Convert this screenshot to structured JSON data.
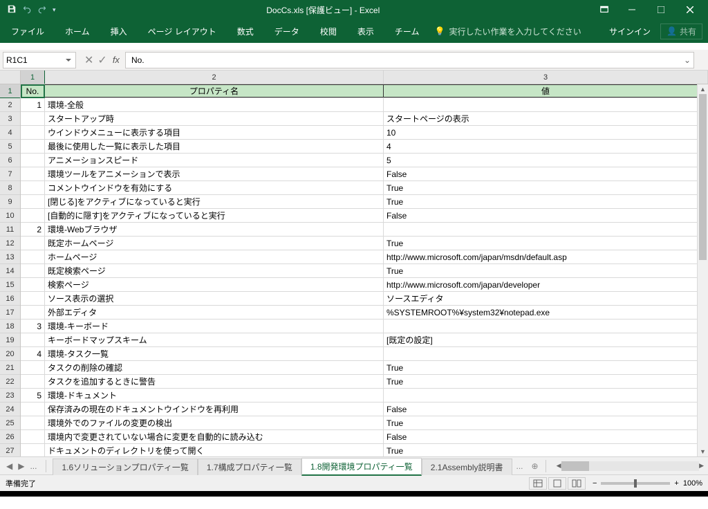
{
  "title": "DocCs.xls [保護ビュー] - Excel",
  "ribbon": {
    "file": "ファイル",
    "home": "ホーム",
    "insert": "挿入",
    "pagelayout": "ページ レイアウト",
    "formulas": "数式",
    "data": "データ",
    "review": "校閲",
    "view": "表示",
    "team": "チーム",
    "tellme": "実行したい作業を入力してください",
    "signin": "サインイン",
    "share": "共有"
  },
  "namebox": "R1C1",
  "fx_symbol": "fx",
  "formula": "No.",
  "col_headers": [
    "1",
    "2",
    "3"
  ],
  "chart_data": {
    "type": "table",
    "columns": [
      "No.",
      "プロパティ名",
      "値"
    ],
    "rows": [
      {
        "no": "1",
        "name": "環境-全般",
        "value": ""
      },
      {
        "no": "",
        "name": "スタートアップ時",
        "value": "スタートページの表示"
      },
      {
        "no": "",
        "name": "ウインドウメニューに表示する項目",
        "value": "10"
      },
      {
        "no": "",
        "name": "最後に使用した一覧に表示した項目",
        "value": "4"
      },
      {
        "no": "",
        "name": "アニメーションスピード",
        "value": "5"
      },
      {
        "no": "",
        "name": "環境ツールをアニメーションで表示",
        "value": "False"
      },
      {
        "no": "",
        "name": "コメントウインドウを有効にする",
        "value": "True"
      },
      {
        "no": "",
        "name": "[閉じる]をアクティブになっていると実行",
        "value": "True"
      },
      {
        "no": "",
        "name": "[自動的に隠す]をアクティブになっていると実行",
        "value": "False"
      },
      {
        "no": "2",
        "name": "環境-Webブラウザ",
        "value": ""
      },
      {
        "no": "",
        "name": "既定ホームページ",
        "value": "True"
      },
      {
        "no": "",
        "name": "ホームページ",
        "value": "http://www.microsoft.com/japan/msdn/default.asp"
      },
      {
        "no": "",
        "name": "既定検索ページ",
        "value": "True"
      },
      {
        "no": "",
        "name": "検索ページ",
        "value": "http://www.microsoft.com/japan/developer"
      },
      {
        "no": "",
        "name": "ソース表示の選択",
        "value": "ソースエディタ"
      },
      {
        "no": "",
        "name": "外部エディタ",
        "value": "%SYSTEMROOT%¥system32¥notepad.exe"
      },
      {
        "no": "3",
        "name": "環境-キーボード",
        "value": ""
      },
      {
        "no": "",
        "name": "キーボードマップスキーム",
        "value": "[既定の設定]"
      },
      {
        "no": "4",
        "name": "環境-タスク一覧",
        "value": ""
      },
      {
        "no": "",
        "name": "タスクの削除の確認",
        "value": "True"
      },
      {
        "no": "",
        "name": "タスクを追加するときに警告",
        "value": "True"
      },
      {
        "no": "5",
        "name": "環境-ドキュメント",
        "value": ""
      },
      {
        "no": "",
        "name": "保存済みの現在のドキュメントウインドウを再利用",
        "value": "False"
      },
      {
        "no": "",
        "name": "環境外でのファイルの変更の検出",
        "value": "True"
      },
      {
        "no": "",
        "name": "環境内で変更されていない場合に変更を自動的に読み込む",
        "value": "False"
      },
      {
        "no": "",
        "name": "ドキュメントのディレクトリを使って開く",
        "value": "True"
      }
    ]
  },
  "tabs": {
    "t1": "1.6ソリューションプロパティ一覧",
    "t2": "1.7構成プロパティ一覧",
    "t3": "1.8開発環境プロパティ一覧",
    "t4": "2.1Assembly説明書",
    "more": "..."
  },
  "status": {
    "ready": "準備完了",
    "zoom": "100%"
  }
}
